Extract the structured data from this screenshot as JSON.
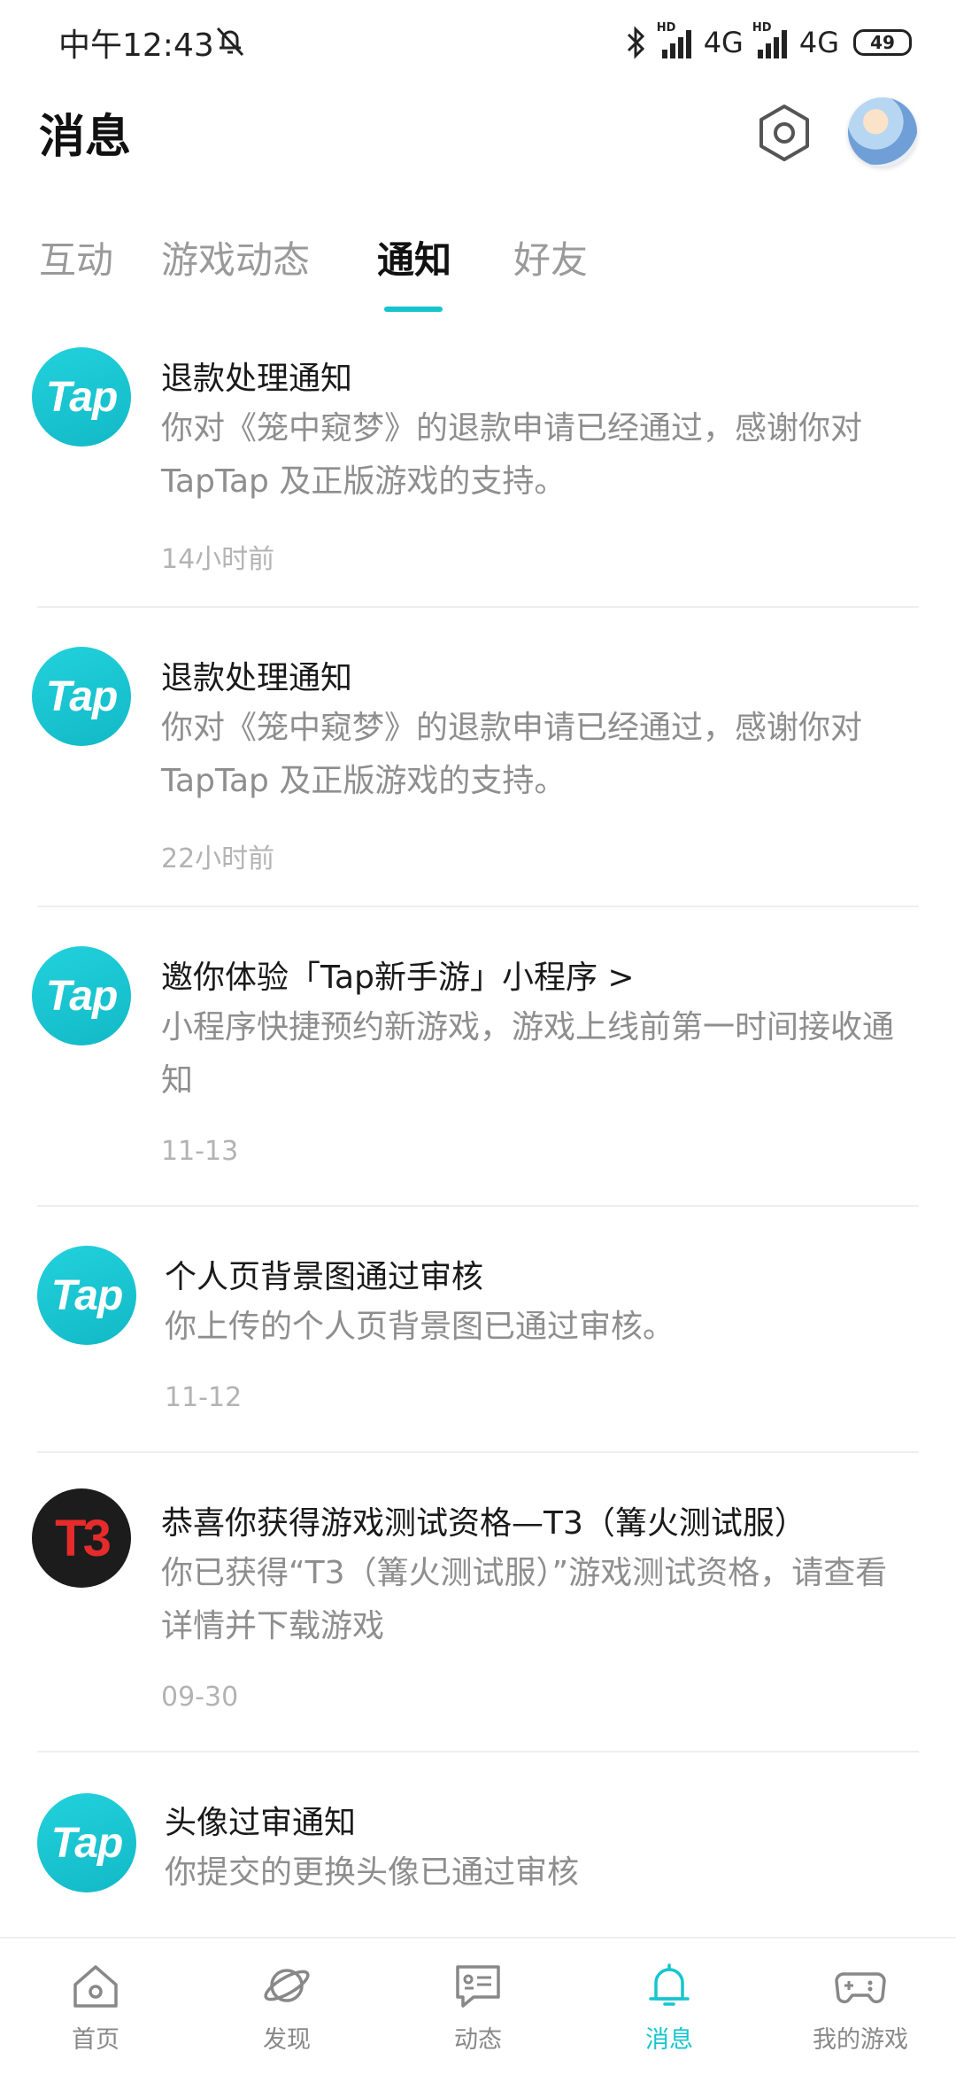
{
  "status_bar": {
    "time": "中午12:43",
    "network_1": "4G",
    "network_2": "4G",
    "battery": "49",
    "hd_1": "HD",
    "hd_2": "HD"
  },
  "header": {
    "title": "消息"
  },
  "tabs": [
    {
      "label": "互动"
    },
    {
      "label": "游戏动态"
    },
    {
      "label": "通知"
    },
    {
      "label": "好友"
    }
  ],
  "active_tab": "通知",
  "accent_color": "#15c5ce",
  "notifications": [
    {
      "logo": "Tap",
      "title": "退款处理通知",
      "body": "你对《笼中窥梦》的退款申请已经通过，感谢你对 TapTap 及正版游戏的支持。",
      "time": "14小时前"
    },
    {
      "logo": "Tap",
      "title": "退款处理通知",
      "body": "你对《笼中窥梦》的退款申请已经通过，感谢你对 TapTap 及正版游戏的支持。",
      "time": "22小时前"
    },
    {
      "logo": "Tap",
      "title": "邀你体验「Tap新手游」小程序 >",
      "body": "小程序快捷预约新游戏，游戏上线前第一时间接收通知",
      "time": "11-13"
    },
    {
      "logo": "Tap",
      "title": "个人页背景图通过审核",
      "body": "你上传的个人页背景图已通过审核。",
      "time": "11-12"
    },
    {
      "logo": "T3",
      "title": "恭喜你获得游戏测试资格—T3（篝火测试服）",
      "body": "你已获得“T3（篝火测试服）”游戏测试资格，请查看详情并下载游戏",
      "time": "09-30"
    },
    {
      "logo": "Tap",
      "title": "头像过审通知",
      "body": "你提交的更换头像已通过审核",
      "time": ""
    }
  ],
  "bottom_nav": [
    {
      "label": "首页",
      "icon": "home-icon"
    },
    {
      "label": "发现",
      "icon": "planet-icon"
    },
    {
      "label": "动态",
      "icon": "chat-icon"
    },
    {
      "label": "消息",
      "icon": "bell-icon"
    },
    {
      "label": "我的游戏",
      "icon": "gamepad-icon"
    }
  ],
  "active_nav": "消息"
}
